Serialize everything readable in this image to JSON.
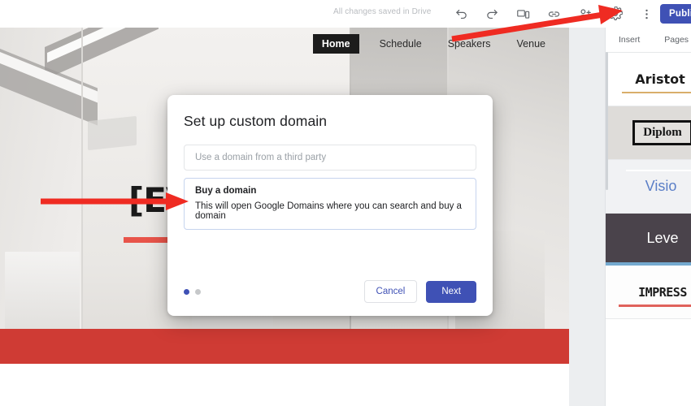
{
  "topbar": {
    "save_status": "All changes saved in Drive",
    "publish_label": "Publish",
    "icons": [
      {
        "name": "undo-icon",
        "label": "Undo"
      },
      {
        "name": "redo-icon",
        "label": "Redo"
      },
      {
        "name": "preview-icon",
        "label": "Preview"
      },
      {
        "name": "link-icon",
        "label": "Copy published site link"
      },
      {
        "name": "add-person-icon",
        "label": "Share with others"
      },
      {
        "name": "gear-icon",
        "label": "Settings"
      },
      {
        "name": "more-vertical-icon",
        "label": "More"
      }
    ]
  },
  "site": {
    "nav": [
      {
        "label": "Home",
        "active": true
      },
      {
        "label": "Schedule",
        "active": false
      },
      {
        "label": "Speakers",
        "active": false
      },
      {
        "label": "Venue",
        "active": false
      }
    ],
    "hero_title": "[EV",
    "accent_color": "#e8544a",
    "band_color": "#cf3b34"
  },
  "right_panel": {
    "tabs": [
      {
        "label": "Insert"
      },
      {
        "label": "Pages"
      }
    ],
    "templates": [
      {
        "label": "Aristot",
        "style": "aristotle"
      },
      {
        "label": "Diplom",
        "style": "diploma"
      },
      {
        "label": "Visio",
        "style": "vision"
      },
      {
        "label": "Leve",
        "style": "level"
      },
      {
        "label": "IMPRESS",
        "style": "impress"
      }
    ]
  },
  "dialog": {
    "title": "Set up custom domain",
    "third_party_placeholder": "Use a domain from a third party",
    "buy_option": {
      "title": "Buy a domain",
      "description": "This will open Google Domains where you can search and buy a domain"
    },
    "dots": [
      {
        "active": true
      },
      {
        "active": false
      }
    ],
    "cancel_label": "Cancel",
    "next_label": "Next"
  },
  "annotations": {
    "arrow_color": "#ef2b22",
    "arrow_top_target": "gear-icon",
    "arrow_left_target": "buy-a-domain-option"
  }
}
